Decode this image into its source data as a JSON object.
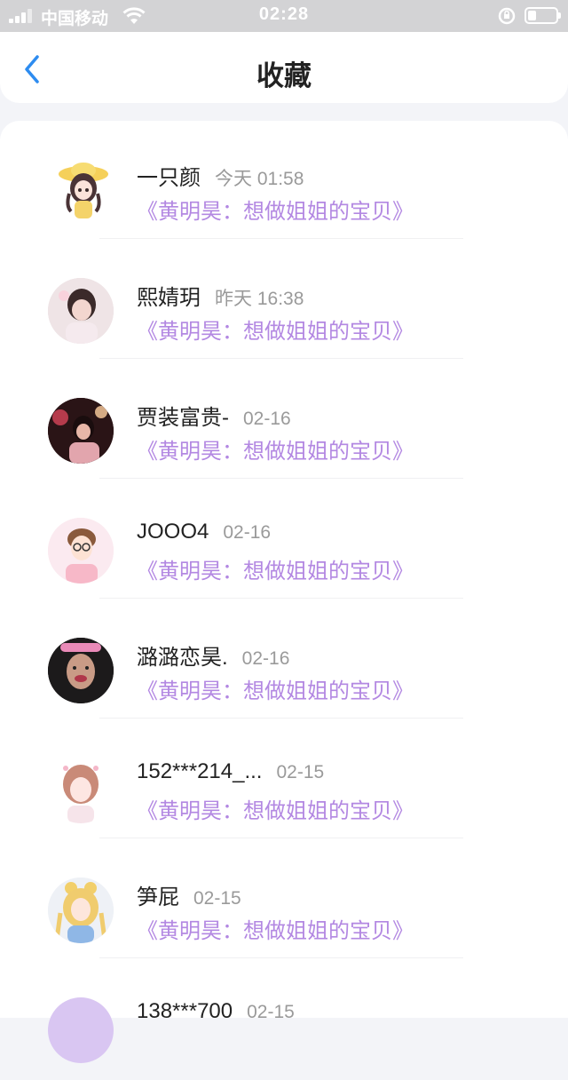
{
  "status": {
    "carrier": "中国移动",
    "time": "02:28"
  },
  "nav": {
    "title": "收藏",
    "back_icon": "chevron-left-icon",
    "accent": "#2d8cf0"
  },
  "items": [
    {
      "name": "一只颜",
      "time": "今天 01:58",
      "post": "《黄明昊：想做姐姐的宝贝》"
    },
    {
      "name": "熙婧玥",
      "time": "昨天 16:38",
      "post": "《黄明昊：想做姐姐的宝贝》"
    },
    {
      "name": "贾装富贵-",
      "time": "02-16",
      "post": "《黄明昊：想做姐姐的宝贝》"
    },
    {
      "name": "JOOO4",
      "time": "02-16",
      "post": "《黄明昊：想做姐姐的宝贝》"
    },
    {
      "name": "潞潞恋昊.",
      "time": "02-16",
      "post": "《黄明昊：想做姐姐的宝贝》"
    },
    {
      "name": "152***214_...",
      "time": "02-15",
      "post": "《黄明昊：想做姐姐的宝贝》"
    },
    {
      "name": "笋屁",
      "time": "02-15",
      "post": "《黄明昊：想做姐姐的宝贝》"
    },
    {
      "name": "138***700",
      "time": "02-15",
      "post": ""
    }
  ],
  "colors": {
    "post_link": "#b388e2",
    "timestamp": "#9a9a9a"
  }
}
